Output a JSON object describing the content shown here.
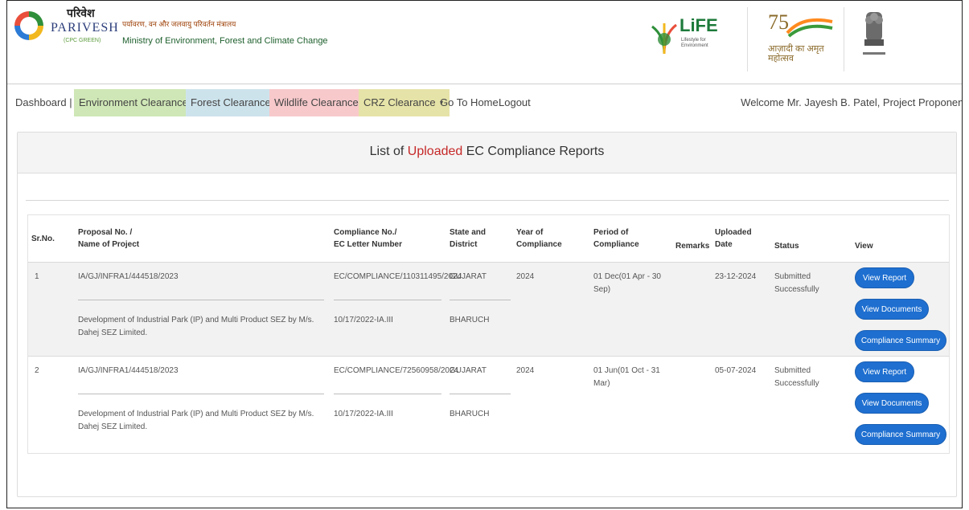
{
  "header": {
    "logo_hindi": "परिवेश",
    "logo_name": "PARIVESH",
    "logo_tag": "(CPC GREEN)",
    "ministry_hindi": "पर्यावरण, वन और जलवायु परिवर्तन मंत्रालय",
    "ministry_english": "Ministry of Environment, Forest and Climate Change",
    "life_logo": "LiFE",
    "life_tagline": "Lifestyle for Environment",
    "azadi_number": "75",
    "azadi_text": "आज़ादी का अमृत महोत्सव"
  },
  "nav": {
    "dashboard": "Dashboard |",
    "environment": "Environment Clearance",
    "forest": "Forest Clearance",
    "wildlife": "Wildlife Clearance",
    "crz": "CRZ Clearance",
    "go_home": "Go To Home",
    "logout": "Logout",
    "welcome": "Welcome Mr. Jayesh B. Patel, Project Proponent",
    "colors": {
      "environment": "#cfe7b6",
      "forest": "#cde3ec",
      "wildlife": "#f7c9cb",
      "crz": "#e6e3a8"
    }
  },
  "panel": {
    "title_pre": "List of ",
    "title_highlight": "Uploaded",
    "title_post": " EC Compliance Reports"
  },
  "table": {
    "headers": {
      "srno": "Sr.No.",
      "proposal_1": "Proposal No. /",
      "proposal_2": "Name of Project",
      "compliance_1": "Compliance No./",
      "compliance_2": "EC Letter Number",
      "state_1": "State and",
      "state_2": "District",
      "year_1": "Year of",
      "year_2": "Compliance",
      "period_1": "Period of",
      "period_2": "Compliance",
      "remarks": "Remarks",
      "uploaded_1": "Uploaded",
      "uploaded_2": "Date",
      "status": "Status",
      "view": "View"
    },
    "rows": [
      {
        "sr": "1",
        "proposal_no": "IA/GJ/INFRA1/444518/2023",
        "project_name": "Development of Industrial Park (IP) and Multi Product SEZ by M/s. Dahej SEZ Limited.",
        "compliance_no": "EC/COMPLIANCE/110311495/2024",
        "ec_letter": "10/17/2022-IA.III",
        "state": "GUJARAT",
        "district": "BHARUCH",
        "year": "2024",
        "period": "01 Dec(01 Apr - 30 Sep)",
        "remarks": "",
        "uploaded": "23-12-2024",
        "status": "Submitted Successfully",
        "btn_report": "View Report",
        "btn_docs": "View Documents",
        "btn_summary": "Compliance Summary"
      },
      {
        "sr": "2",
        "proposal_no": "IA/GJ/INFRA1/444518/2023",
        "project_name": "Development of Industrial Park (IP) and Multi Product SEZ by M/s. Dahej SEZ Limited.",
        "compliance_no": "EC/COMPLIANCE/72560958/2024",
        "ec_letter": "10/17/2022-IA.III",
        "state": "GUJARAT",
        "district": "BHARUCH",
        "year": "2024",
        "period": "01 Jun(01 Oct - 31 Mar)",
        "remarks": "",
        "uploaded": "05-07-2024",
        "status": "Submitted Successfully",
        "btn_report": "View Report",
        "btn_docs": "View Documents",
        "btn_summary": "Compliance Summary"
      }
    ]
  }
}
